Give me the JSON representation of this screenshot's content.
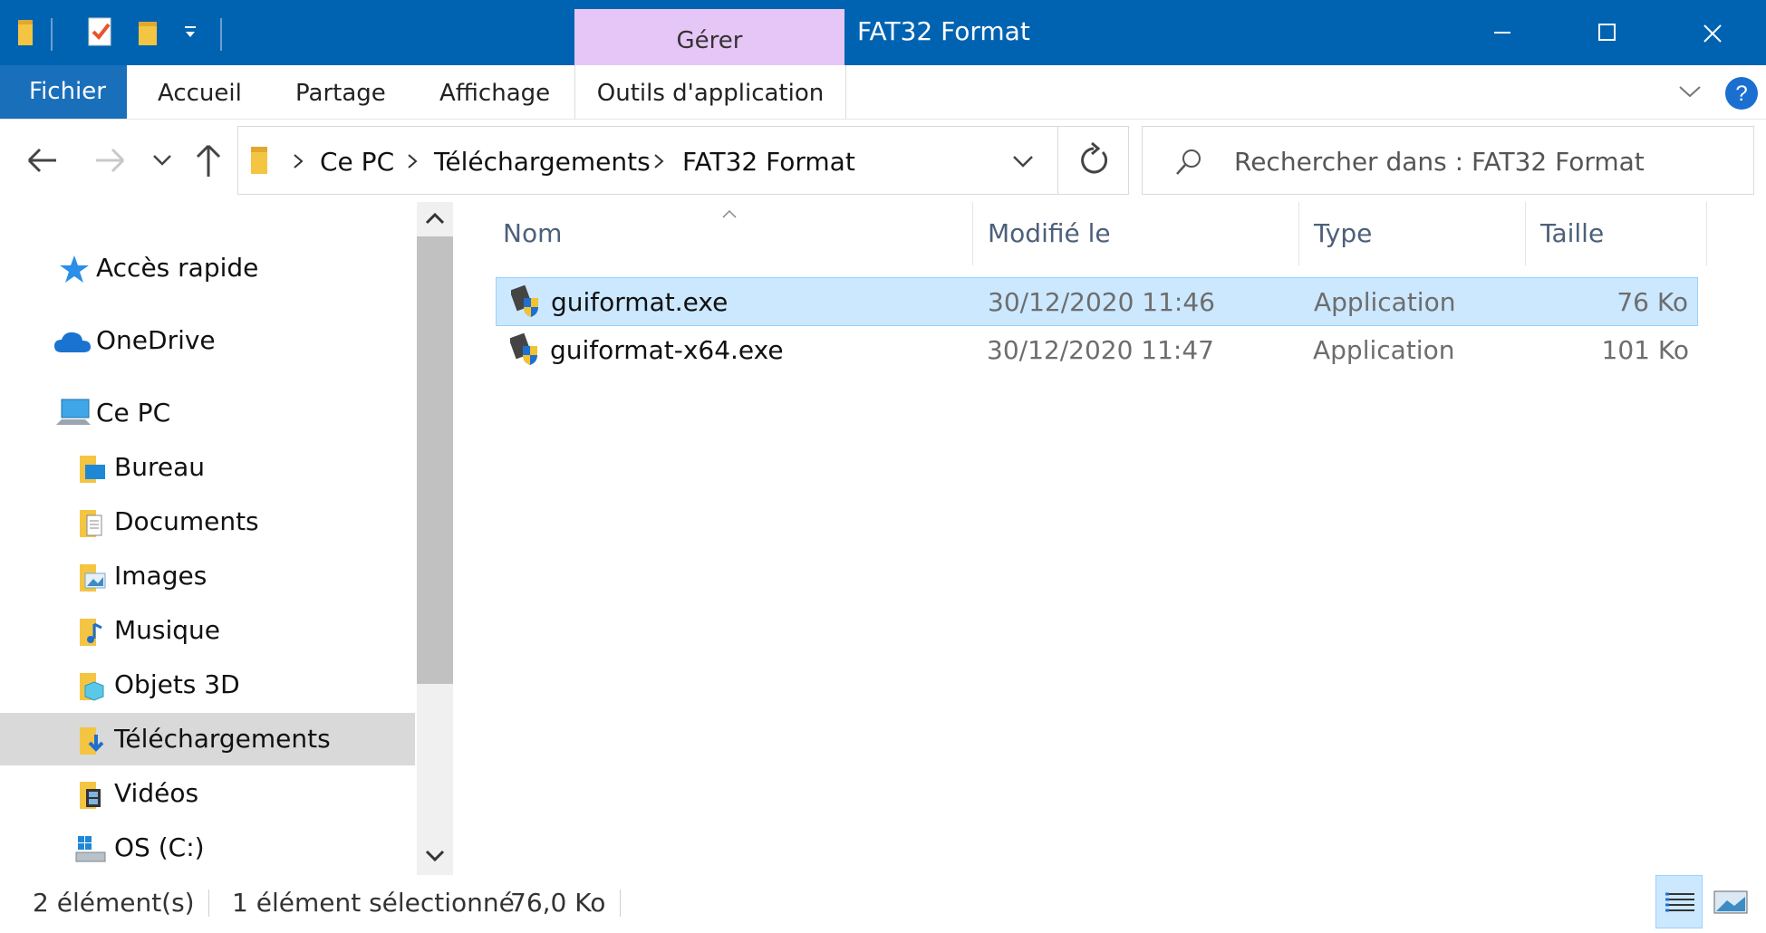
{
  "window": {
    "title": "FAT32 Format",
    "context_tab_label": "Gérer",
    "accent_color": "#0063b1",
    "context_tab_color": "#e6c6f6"
  },
  "ribbon": {
    "tabs": {
      "file": "Fichier",
      "home": "Accueil",
      "share": "Partage",
      "view": "Affichage",
      "app_tools": "Outils d'application"
    }
  },
  "nav": {
    "breadcrumb": [
      "Ce PC",
      "Téléchargements",
      "FAT32 Format"
    ],
    "search_placeholder": "Rechercher dans : FAT32 Format"
  },
  "sidebar": {
    "items": [
      {
        "label": "Accès rapide",
        "icon": "star-icon"
      },
      {
        "label": "OneDrive",
        "icon": "cloud-icon"
      },
      {
        "label": "Ce PC",
        "icon": "computer-icon"
      },
      {
        "label": "Bureau",
        "icon": "desktop-folder-icon"
      },
      {
        "label": "Documents",
        "icon": "documents-folder-icon"
      },
      {
        "label": "Images",
        "icon": "pictures-folder-icon"
      },
      {
        "label": "Musique",
        "icon": "music-folder-icon"
      },
      {
        "label": "Objets 3D",
        "icon": "3d-objects-folder-icon"
      },
      {
        "label": "Téléchargements",
        "icon": "downloads-folder-icon",
        "selected": true
      },
      {
        "label": "Vidéos",
        "icon": "videos-folder-icon"
      },
      {
        "label": "OS (C:)",
        "icon": "drive-icon"
      }
    ]
  },
  "files": {
    "columns": {
      "name": "Nom",
      "modified": "Modifié le",
      "type": "Type",
      "size": "Taille"
    },
    "rows": [
      {
        "name": "guiformat.exe",
        "modified": "30/12/2020 11:46",
        "type": "Application",
        "size": "76 Ko",
        "selected": true
      },
      {
        "name": "guiformat-x64.exe",
        "modified": "30/12/2020 11:47",
        "type": "Application",
        "size": "101 Ko",
        "selected": false
      }
    ]
  },
  "status": {
    "count": "2 élément(s)",
    "selection": "1 élément sélectionné",
    "selection_size": "76,0 Ko"
  }
}
